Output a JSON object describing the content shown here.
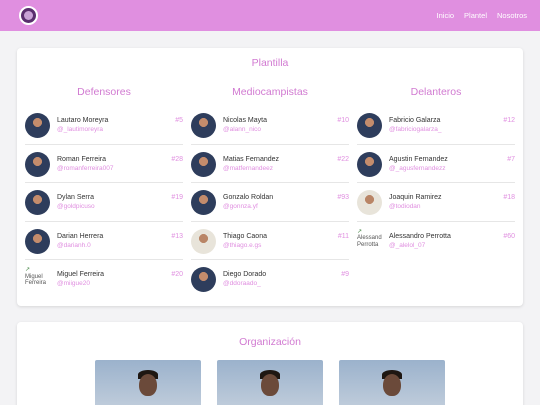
{
  "nav": {
    "links": [
      "Inicio",
      "Plantel",
      "Nosotros"
    ]
  },
  "squad": {
    "title": "Plantilla",
    "columns": [
      {
        "title": "Defensores",
        "players": [
          {
            "name": "Lautaro Moreyra",
            "handle": "@_lautimoreyra",
            "number": "#5",
            "avatar": "dark"
          },
          {
            "name": "Roman Ferreira",
            "handle": "@romanferreira007",
            "number": "#28",
            "avatar": "dark"
          },
          {
            "name": "Dylan Serra",
            "handle": "@goldpicuso",
            "number": "#19",
            "avatar": "dark"
          },
          {
            "name": "Darian Herrera",
            "handle": "@darianh.0",
            "number": "#13",
            "avatar": "dark"
          },
          {
            "name": "Miguel Ferreira",
            "handle": "@miigue20",
            "number": "#20",
            "avatar": "broken",
            "alt": "Miguel Ferreira"
          }
        ]
      },
      {
        "title": "Mediocampistas",
        "players": [
          {
            "name": "Nicolas Mayta",
            "handle": "@alann_nico",
            "number": "#10",
            "avatar": "dark"
          },
          {
            "name": "Matias Fernandez",
            "handle": "@matfernandeez",
            "number": "#22",
            "avatar": "dark"
          },
          {
            "name": "Gonzalo Roldan",
            "handle": "@gonnza.yf",
            "number": "#93",
            "avatar": "dark"
          },
          {
            "name": "Thiago Caona",
            "handle": "@thiago.e.gs",
            "number": "#11",
            "avatar": "light"
          },
          {
            "name": "Diego Dorado",
            "handle": "@ddoraado_",
            "number": "#9",
            "avatar": "dark"
          }
        ]
      },
      {
        "title": "Delanteros",
        "players": [
          {
            "name": "Fabricio Galarza",
            "handle": "@fabriciogalarza_",
            "number": "#12",
            "avatar": "dark"
          },
          {
            "name": "Agustin Fernandez",
            "handle": "@_agusfernandezz",
            "number": "#7",
            "avatar": "dark"
          },
          {
            "name": "Joaquin Ramirez",
            "handle": "@todiodan",
            "number": "#18",
            "avatar": "light"
          },
          {
            "name": "Alessandro Perrotta",
            "handle": "@_alelol_07",
            "number": "#60",
            "avatar": "broken",
            "alt": "Alessandro Perrotta"
          }
        ]
      }
    ]
  },
  "organization": {
    "title": "Organización",
    "photo_count": 3
  }
}
